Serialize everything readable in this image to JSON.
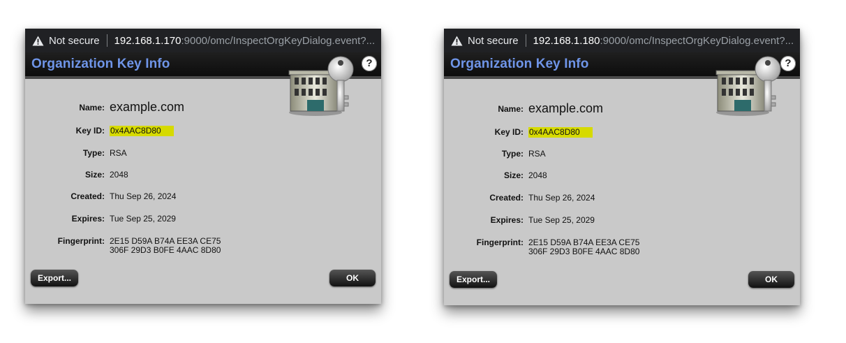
{
  "dialogs": [
    {
      "url": {
        "not_secure": "Not secure",
        "host": "192.168.1.170",
        "path": ":9000/omc/InspectOrgKeyDialog.event?..."
      },
      "title": "Organization Key Info",
      "help": "?",
      "fields": {
        "name_label": "Name:",
        "name": "example.com",
        "keyid_label": "Key ID:",
        "keyid": "0x4AAC8D80",
        "type_label": "Type:",
        "type": "RSA",
        "size_label": "Size:",
        "size": "2048",
        "created_label": "Created:",
        "created": "Thu Sep 26, 2024",
        "expires_label": "Expires:",
        "expires": "Tue Sep 25, 2029",
        "fingerprint_label": "Fingerprint:",
        "fingerprint_line1": "2E15 D59A B74A EE3A CE75",
        "fingerprint_line2": "306F 29D3 B0FE 4AAC 8D80"
      },
      "buttons": {
        "export": "Export...",
        "ok": "OK"
      }
    },
    {
      "url": {
        "not_secure": "Not secure",
        "host": "192.168.1.180",
        "path": ":9000/omc/InspectOrgKeyDialog.event?..."
      },
      "title": "Organization Key Info",
      "help": "?",
      "fields": {
        "name_label": "Name:",
        "name": "example.com",
        "keyid_label": "Key ID:",
        "keyid": "0x4AAC8D80",
        "type_label": "Type:",
        "type": "RSA",
        "size_label": "Size:",
        "size": "2048",
        "created_label": "Created:",
        "created": "Thu Sep 26, 2024",
        "expires_label": "Expires:",
        "expires": "Tue Sep 25, 2029",
        "fingerprint_label": "Fingerprint:",
        "fingerprint_line1": "2E15 D59A B74A EE3A CE75",
        "fingerprint_line2": "306F 29D3 B0FE 4AAC 8D80"
      },
      "buttons": {
        "export": "Export...",
        "ok": "OK"
      }
    }
  ],
  "colors": {
    "title": "#6f95e8",
    "highlight": "#d6da00",
    "dialog_bg": "#c9c9c9",
    "urlbar_bg": "#202124"
  },
  "icons": [
    "warning-icon",
    "help-icon",
    "building-key-icon"
  ]
}
